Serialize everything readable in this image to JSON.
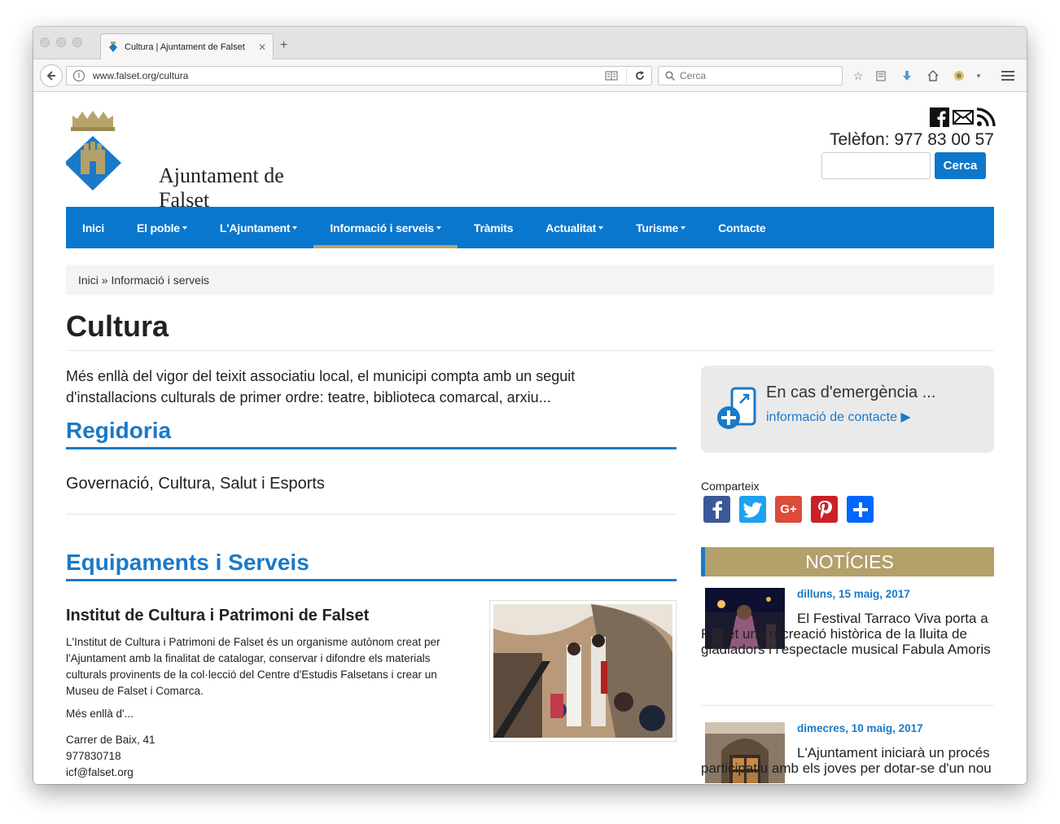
{
  "browser": {
    "tab_title": "Cultura | Ajuntament de Falset",
    "url": "www.falset.org/cultura",
    "search_placeholder": "Cerca"
  },
  "header": {
    "logo_text": "Ajuntament de Falset",
    "phone": "Telèfon: 977 83 00 57",
    "search_button": "Cerca"
  },
  "nav": [
    {
      "label": "Inici",
      "dropdown": false
    },
    {
      "label": "El poble",
      "dropdown": true
    },
    {
      "label": "L'Ajuntament",
      "dropdown": true
    },
    {
      "label": "Informació i serveis",
      "dropdown": true
    },
    {
      "label": "Tràmits",
      "dropdown": false
    },
    {
      "label": "Actualitat",
      "dropdown": true
    },
    {
      "label": "Turisme",
      "dropdown": true
    },
    {
      "label": "Contacte",
      "dropdown": false
    }
  ],
  "nav_active": "Informació i serveis",
  "breadcrumb": "Inici » Informació i serveis",
  "page_title": "Cultura",
  "intro": "Més enllà del vigor del teixit associatiu local, el municipi compta amb un seguit d'installacions culturals de primer ordre: teatre, biblioteca comarcal, arxiu...",
  "regidoria": {
    "heading": "Regidoria",
    "text": "Governació, Cultura, Salut i Esports"
  },
  "equipaments": {
    "heading": "Equipaments i Serveis",
    "item_title": "Institut de Cultura i Patrimoni de Falset",
    "item_desc": "L'Institut de Cultura i Patrimoni de Falset és un organisme autònom creat per l'Ajuntament amb la finalitat de catalogar, conservar i difondre els materials culturals provinents de la col·lecció del Centre d'Estudis Falsetans i crear un Museu de Falset i Comarca.",
    "item_more": "Més enllà d'...",
    "address": "Carrer de Baix, 41",
    "phone": "977830718",
    "email": "icf@falset.org"
  },
  "emergency": {
    "title": "En cas d'emergència ...",
    "link": "informació de contacte ▶"
  },
  "share": {
    "label": "Comparteix"
  },
  "news": {
    "heading": "NOTÍCIES",
    "items": [
      {
        "date": "dilluns, 15 maig, 2017",
        "title": "El Festival Tarraco Viva porta a Falset una recreació històrica de la lluita de gladiadors i l'espectacle musical Fabula Amoris"
      },
      {
        "date": "dimecres, 10 maig, 2017",
        "title": "L'Ajuntament iniciarà un procés participatiu amb els joves per dotar-se d'un nou"
      }
    ]
  },
  "colors": {
    "brand_blue": "#0a77cf",
    "link_blue": "#1a79c8",
    "gold": "#b3a06a"
  }
}
